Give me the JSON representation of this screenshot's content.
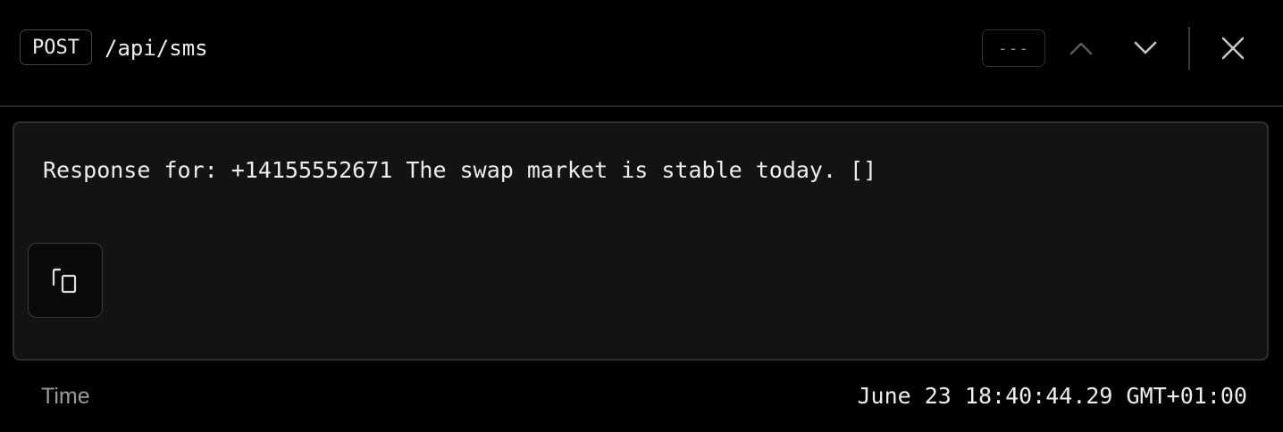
{
  "header": {
    "method": "POST",
    "path": "/api/sms",
    "counter": "---"
  },
  "icons": {
    "prev": "chevron-up-icon",
    "next": "chevron-down-icon",
    "close": "close-icon",
    "copy": "copy-icon"
  },
  "response": {
    "text": "Response for: +14155552671 The swap market is stable today. []"
  },
  "meta": {
    "time_label": "Time",
    "time_value": "June 23 18:40:44.29 GMT+01:00"
  },
  "colors": {
    "background": "#000000",
    "panel": "#131313",
    "border": "#2e2e2e",
    "text": "#ededed",
    "muted": "#9a9a9a"
  }
}
